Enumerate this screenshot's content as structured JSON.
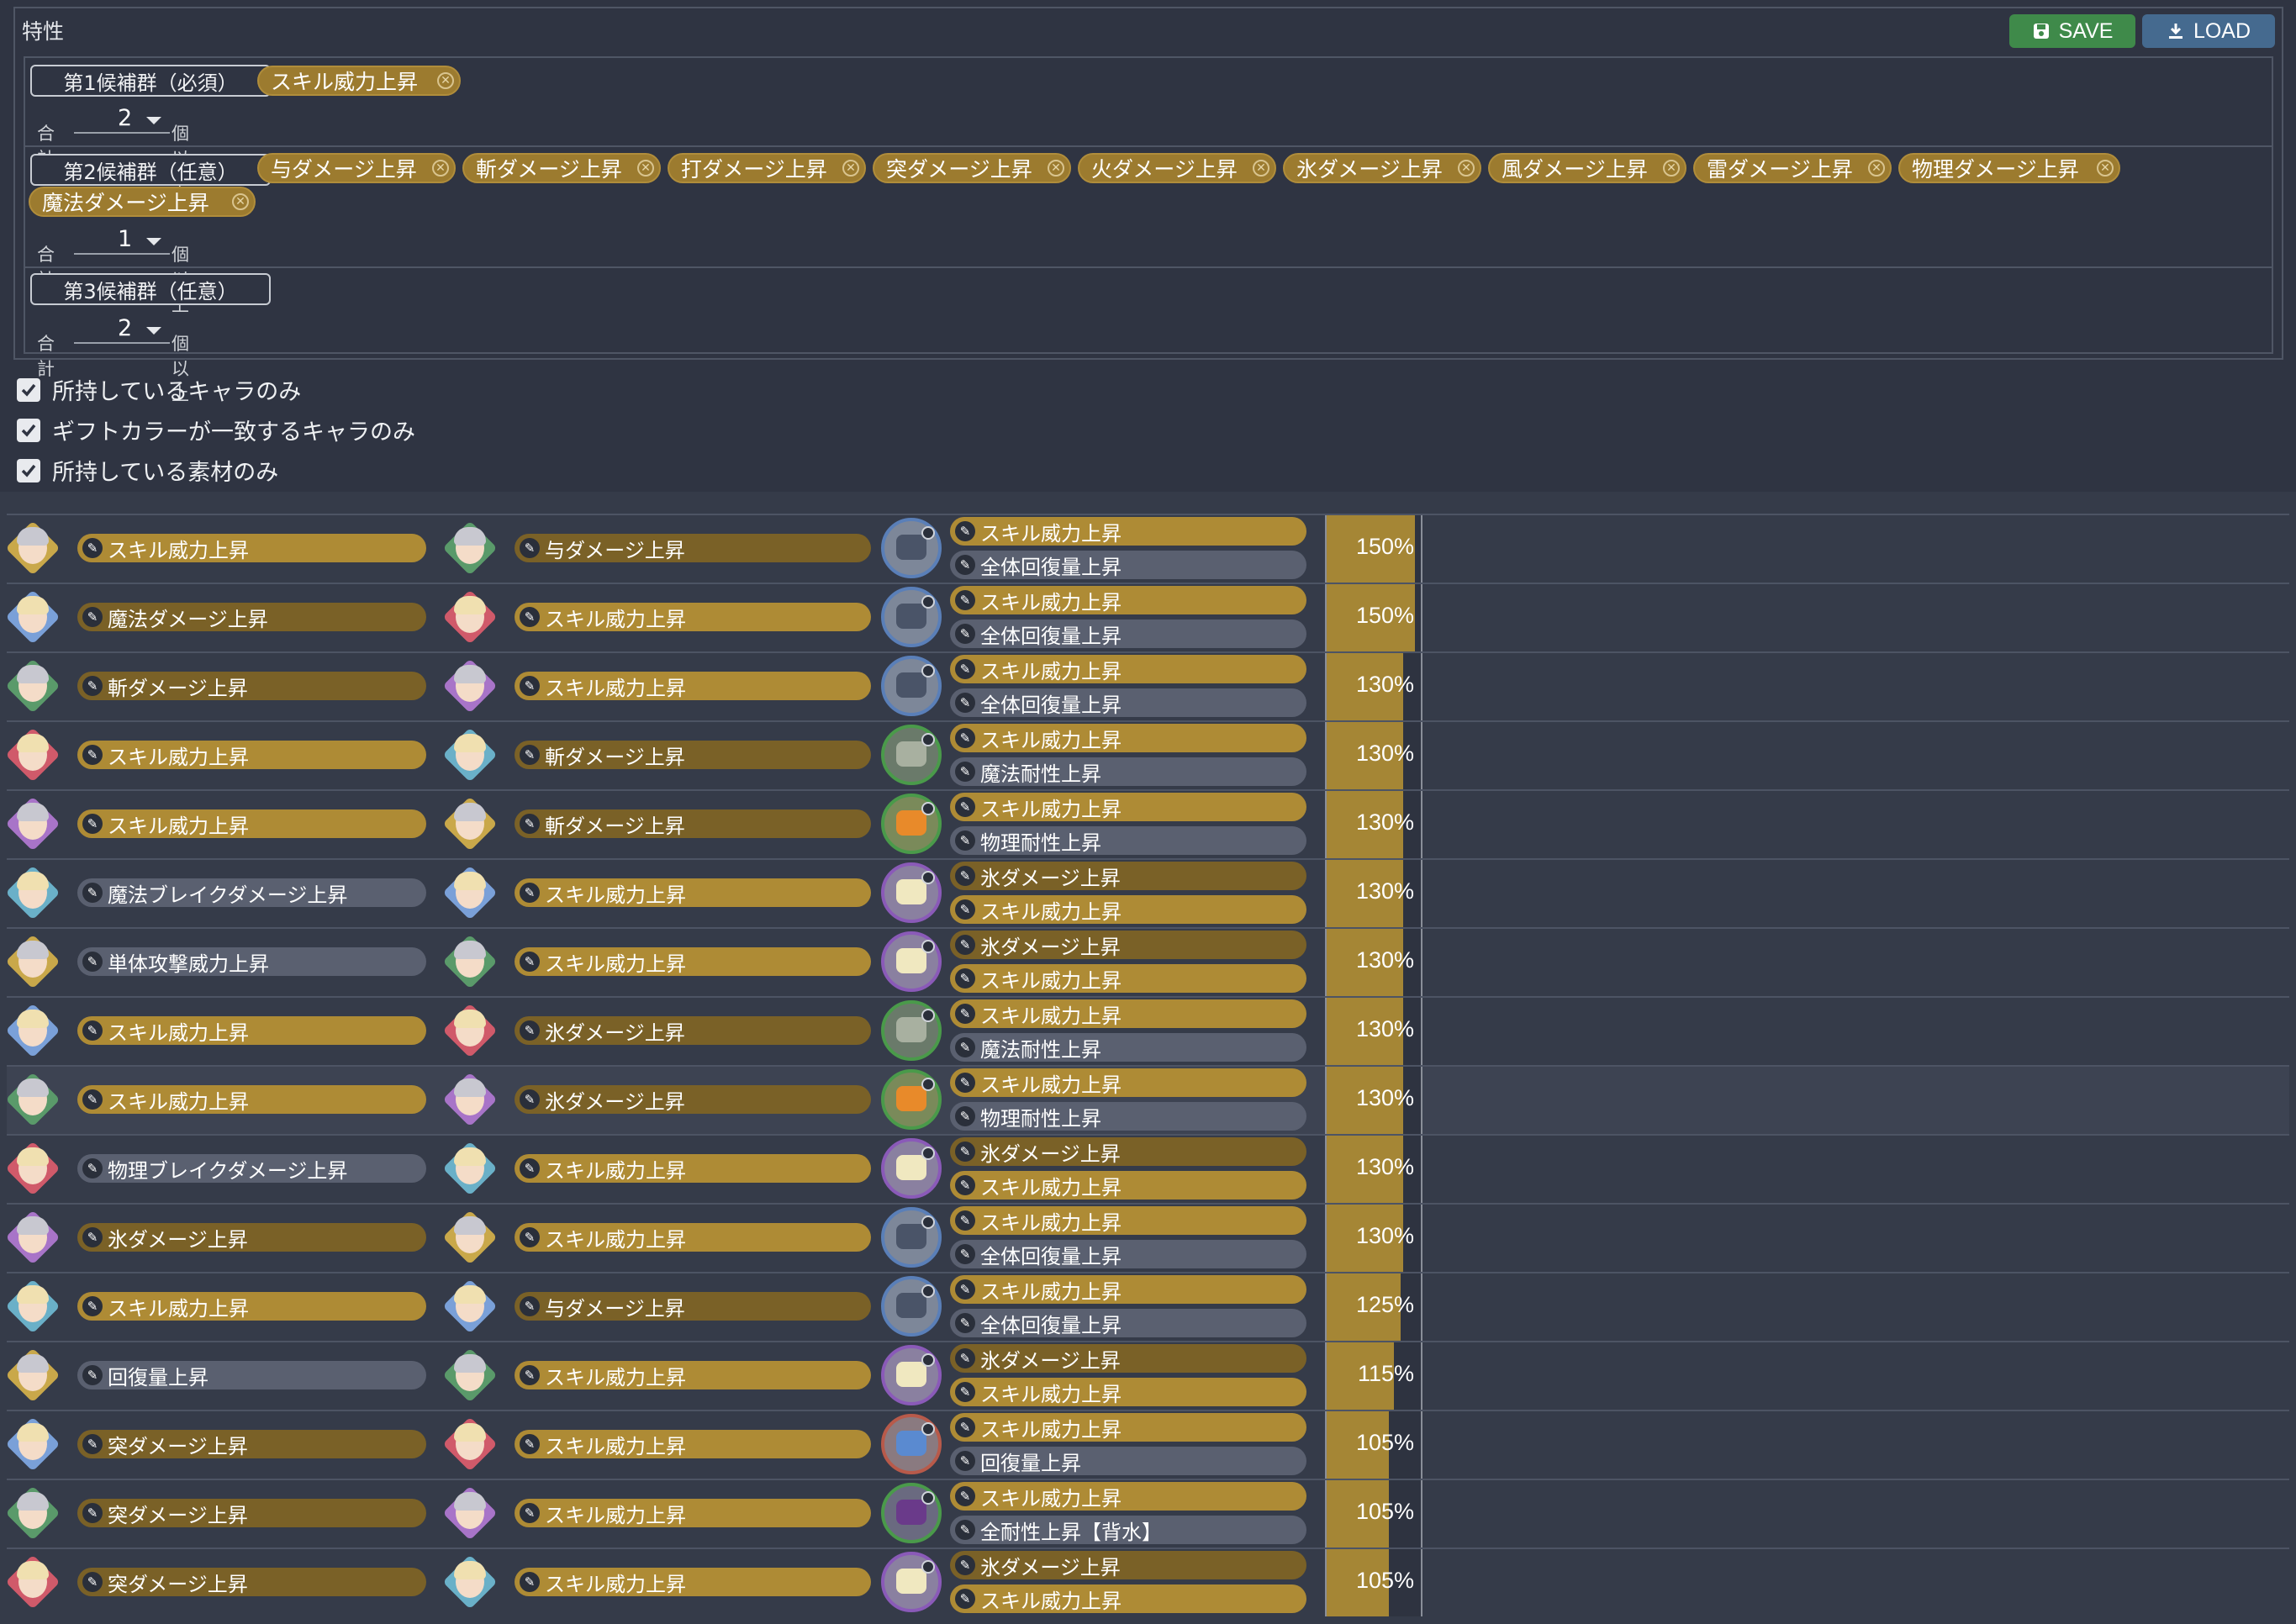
{
  "panel": {
    "legend": "特性",
    "save_label": "SAVE",
    "load_label": "LOAD",
    "groups": [
      {
        "label": "第1候補群（必須）",
        "chips": [
          "スキル威力上昇"
        ],
        "total_prefix": "合計",
        "count": "2",
        "total_suffix": "個以上"
      },
      {
        "label": "第2候補群（任意）",
        "chips": [
          "与ダメージ上昇",
          "斬ダメージ上昇",
          "打ダメージ上昇",
          "突ダメージ上昇",
          "火ダメージ上昇",
          "氷ダメージ上昇",
          "風ダメージ上昇",
          "雷ダメージ上昇",
          "物理ダメージ上昇",
          "魔法ダメージ上昇"
        ],
        "total_prefix": "合計",
        "count": "1",
        "total_suffix": "個以上"
      },
      {
        "label": "第3候補群（任意）",
        "chips": [],
        "total_prefix": "合計",
        "count": "2",
        "total_suffix": "個以上"
      }
    ],
    "checkboxes": [
      {
        "label": "所持しているキャラのみ",
        "checked": true
      },
      {
        "label": "ギフトカラーが一致するキャラのみ",
        "checked": true
      },
      {
        "label": "所持している素材のみ",
        "checked": true
      }
    ]
  },
  "results": [
    {
      "c1": "スキル威力上昇",
      "c1s": "gold",
      "c2": "与ダメージ上昇",
      "c2s": "dark",
      "m1": "スキル威力上昇",
      "m1s": "gold",
      "m2": "全体回復量上昇",
      "m2s": "gray",
      "pct": "150%",
      "val": 1.5,
      "mat": "ship"
    },
    {
      "c1": "魔法ダメージ上昇",
      "c1s": "dark",
      "c2": "スキル威力上昇",
      "c2s": "gold",
      "m1": "スキル威力上昇",
      "m1s": "gold",
      "m2": "全体回復量上昇",
      "m2s": "gray",
      "pct": "150%",
      "val": 1.5,
      "mat": "ship"
    },
    {
      "c1": "斬ダメージ上昇",
      "c1s": "dark",
      "c2": "スキル威力上昇",
      "c2s": "gold",
      "m1": "スキル威力上昇",
      "m1s": "gold",
      "m2": "全体回復量上昇",
      "m2s": "gray",
      "pct": "130%",
      "val": 1.3,
      "mat": "ship"
    },
    {
      "c1": "スキル威力上昇",
      "c1s": "gold",
      "c2": "斬ダメージ上昇",
      "c2s": "dark",
      "m1": "スキル威力上昇",
      "m1s": "gold",
      "m2": "魔法耐性上昇",
      "m2s": "gray",
      "pct": "130%",
      "val": 1.3,
      "mat": "leaf"
    },
    {
      "c1": "スキル威力上昇",
      "c1s": "gold",
      "c2": "斬ダメージ上昇",
      "c2s": "dark",
      "m1": "スキル威力上昇",
      "m1s": "gold",
      "m2": "物理耐性上昇",
      "m2s": "gray",
      "pct": "130%",
      "val": 1.3,
      "mat": "orange"
    },
    {
      "c1": "魔法ブレイクダメージ上昇",
      "c1s": "gray",
      "c2": "スキル威力上昇",
      "c2s": "gold",
      "m1": "氷ダメージ上昇",
      "m1s": "dark",
      "m2": "スキル威力上昇",
      "m2s": "gold",
      "pct": "130%",
      "val": 1.3,
      "mat": "potion"
    },
    {
      "c1": "単体攻撃威力上昇",
      "c1s": "gray",
      "c2": "スキル威力上昇",
      "c2s": "gold",
      "m1": "氷ダメージ上昇",
      "m1s": "dark",
      "m2": "スキル威力上昇",
      "m2s": "gold",
      "pct": "130%",
      "val": 1.3,
      "mat": "potion"
    },
    {
      "c1": "スキル威力上昇",
      "c1s": "gold",
      "c2": "氷ダメージ上昇",
      "c2s": "dark",
      "m1": "スキル威力上昇",
      "m1s": "gold",
      "m2": "魔法耐性上昇",
      "m2s": "gray",
      "pct": "130%",
      "val": 1.3,
      "mat": "leaf"
    },
    {
      "c1": "スキル威力上昇",
      "c1s": "gold",
      "c2": "氷ダメージ上昇",
      "c2s": "dark",
      "m1": "スキル威力上昇",
      "m1s": "gold",
      "m2": "物理耐性上昇",
      "m2s": "gray",
      "pct": "130%",
      "val": 1.3,
      "mat": "orange",
      "highlight": true
    },
    {
      "c1": "物理ブレイクダメージ上昇",
      "c1s": "gray",
      "c2": "スキル威力上昇",
      "c2s": "gold",
      "m1": "氷ダメージ上昇",
      "m1s": "dark",
      "m2": "スキル威力上昇",
      "m2s": "gold",
      "pct": "130%",
      "val": 1.3,
      "mat": "potion"
    },
    {
      "c1": "氷ダメージ上昇",
      "c1s": "dark",
      "c2": "スキル威力上昇",
      "c2s": "gold",
      "m1": "スキル威力上昇",
      "m1s": "gold",
      "m2": "全体回復量上昇",
      "m2s": "gray",
      "pct": "130%",
      "val": 1.3,
      "mat": "ship"
    },
    {
      "c1": "スキル威力上昇",
      "c1s": "gold",
      "c2": "与ダメージ上昇",
      "c2s": "dark",
      "m1": "スキル威力上昇",
      "m1s": "gold",
      "m2": "全体回復量上昇",
      "m2s": "gray",
      "pct": "125%",
      "val": 1.25,
      "mat": "ship"
    },
    {
      "c1": "回復量上昇",
      "c1s": "gray",
      "c2": "スキル威力上昇",
      "c2s": "gold",
      "m1": "氷ダメージ上昇",
      "m1s": "dark",
      "m2": "スキル威力上昇",
      "m2s": "gold",
      "pct": "115%",
      "val": 1.15,
      "mat": "potion"
    },
    {
      "c1": "突ダメージ上昇",
      "c1s": "dark",
      "c2": "スキル威力上昇",
      "c2s": "gold",
      "m1": "スキル威力上昇",
      "m1s": "gold",
      "m2": "回復量上昇",
      "m2s": "gray",
      "pct": "105%",
      "val": 1.05,
      "mat": "jar"
    },
    {
      "c1": "突ダメージ上昇",
      "c1s": "dark",
      "c2": "スキル威力上昇",
      "c2s": "gold",
      "m1": "スキル威力上昇",
      "m1s": "gold",
      "m2": "全耐性上昇【背水】",
      "m2s": "gray",
      "pct": "105%",
      "val": 1.05,
      "mat": "grape"
    },
    {
      "c1": "突ダメージ上昇",
      "c1s": "dark",
      "c2": "スキル威力上昇",
      "c2s": "gold",
      "m1": "氷ダメージ上昇",
      "m1s": "dark",
      "m2": "スキル威力上昇",
      "m2s": "gold",
      "pct": "105%",
      "val": 1.05,
      "mat": "potion"
    }
  ],
  "colors": {
    "gold": "#ae8b35",
    "dark_gold": "#7a6127",
    "gray": "#5a6070",
    "save_green": "#3f8a4a",
    "load_blue": "#456a8f"
  }
}
